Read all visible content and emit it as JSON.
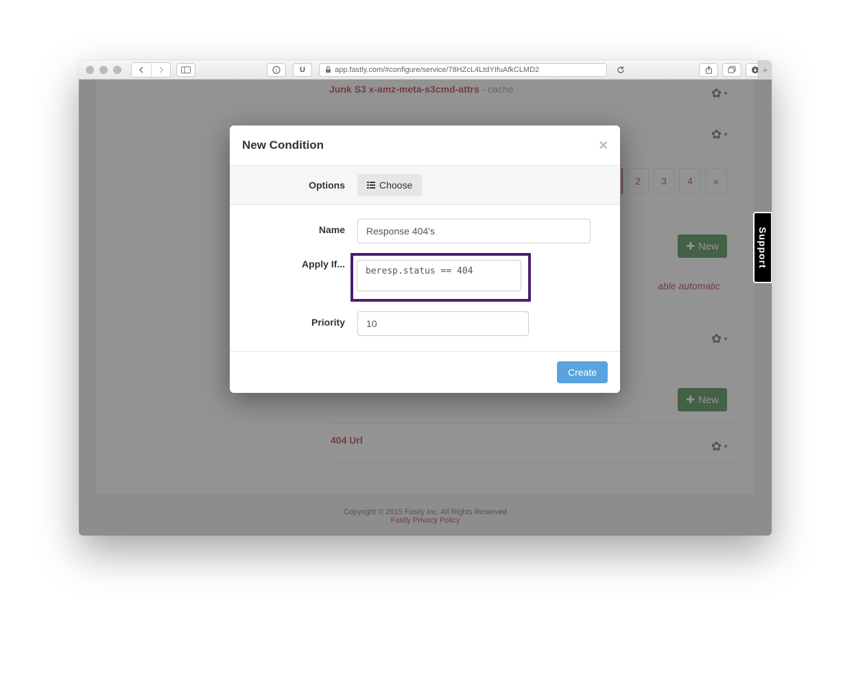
{
  "browser": {
    "url": "app.fastly.com/#configure/service/78HZcL4LtdYIfuAfkCLMD2",
    "info_icon": "i",
    "u_label": "U",
    "new_tab": "+"
  },
  "background": {
    "header_item_title": "Junk S3 x-amz-meta-s3cmd-attrs",
    "header_item_suffix": "- cache",
    "pagination": [
      "2",
      "3",
      "4",
      "»"
    ],
    "new_button": "New",
    "gzip_text": "able automatic",
    "url_404": "404 Url",
    "footer_copyright": "Copyright © 2015 Fastly Inc. All Rights Reserved",
    "footer_link": "Fastly Privacy Policy"
  },
  "modal": {
    "title": "New Condition",
    "options_label": "Options",
    "choose_label": "Choose",
    "name_label": "Name",
    "name_value": "Response 404's",
    "apply_label": "Apply If...",
    "apply_value": "beresp.status == 404",
    "priority_label": "Priority",
    "priority_value": "10",
    "create_label": "Create",
    "close": "×"
  },
  "support_tab": "Support"
}
